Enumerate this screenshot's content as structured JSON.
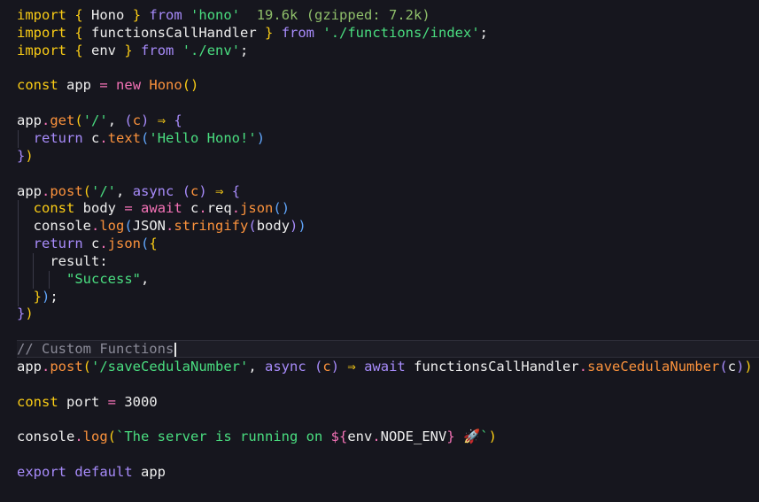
{
  "colors": {
    "background": "#16161e",
    "keyword": "#facc15",
    "keyword_alt": "#a78bfa",
    "string": "#4ade80",
    "function": "#fb923c",
    "operator": "#f472b6",
    "comment": "#8b8b98"
  },
  "lines": [
    {
      "tokens": [
        {
          "t": "import",
          "c": "kw"
        },
        {
          "t": " ",
          "c": "id"
        },
        {
          "t": "{",
          "c": "br"
        },
        {
          "t": " Hono ",
          "c": "id"
        },
        {
          "t": "}",
          "c": "br"
        },
        {
          "t": " ",
          "c": "id"
        },
        {
          "t": "from",
          "c": "kw2"
        },
        {
          "t": " ",
          "c": "id"
        },
        {
          "t": "'hono'",
          "c": "str"
        },
        {
          "t": "  19.6k (gzipped: 7.2k)",
          "c": "hint"
        }
      ]
    },
    {
      "tokens": [
        {
          "t": "import",
          "c": "kw"
        },
        {
          "t": " ",
          "c": "id"
        },
        {
          "t": "{",
          "c": "br"
        },
        {
          "t": " functionsCallHandler ",
          "c": "id"
        },
        {
          "t": "}",
          "c": "br"
        },
        {
          "t": " ",
          "c": "id"
        },
        {
          "t": "from",
          "c": "kw2"
        },
        {
          "t": " ",
          "c": "id"
        },
        {
          "t": "'./functions/index'",
          "c": "str"
        },
        {
          "t": ";",
          "c": "id"
        }
      ]
    },
    {
      "tokens": [
        {
          "t": "import",
          "c": "kw"
        },
        {
          "t": " ",
          "c": "id"
        },
        {
          "t": "{",
          "c": "br"
        },
        {
          "t": " env ",
          "c": "id"
        },
        {
          "t": "}",
          "c": "br"
        },
        {
          "t": " ",
          "c": "id"
        },
        {
          "t": "from",
          "c": "kw2"
        },
        {
          "t": " ",
          "c": "id"
        },
        {
          "t": "'./env'",
          "c": "str"
        },
        {
          "t": ";",
          "c": "id"
        }
      ]
    },
    {
      "tokens": []
    },
    {
      "tokens": [
        {
          "t": "const",
          "c": "kw"
        },
        {
          "t": " app ",
          "c": "id"
        },
        {
          "t": "=",
          "c": "op"
        },
        {
          "t": " ",
          "c": "id"
        },
        {
          "t": "new",
          "c": "op"
        },
        {
          "t": " ",
          "c": "id"
        },
        {
          "t": "Hono",
          "c": "fn"
        },
        {
          "t": "()",
          "c": "br"
        }
      ]
    },
    {
      "tokens": []
    },
    {
      "tokens": [
        {
          "t": "app",
          "c": "id"
        },
        {
          "t": ".",
          "c": "op"
        },
        {
          "t": "get",
          "c": "fn"
        },
        {
          "t": "(",
          "c": "br"
        },
        {
          "t": "'/'",
          "c": "str"
        },
        {
          "t": ", ",
          "c": "id"
        },
        {
          "t": "(",
          "c": "kw2"
        },
        {
          "t": "c",
          "c": "fn"
        },
        {
          "t": ")",
          "c": "kw2"
        },
        {
          "t": " ",
          "c": "id"
        },
        {
          "t": "⇒",
          "c": "kw"
        },
        {
          "t": " ",
          "c": "id"
        },
        {
          "t": "{",
          "c": "kw2"
        }
      ]
    },
    {
      "tokens": [
        {
          "t": "  ",
          "c": "id"
        },
        {
          "t": "return",
          "c": "kw2"
        },
        {
          "t": " c",
          "c": "id"
        },
        {
          "t": ".",
          "c": "op"
        },
        {
          "t": "text",
          "c": "fn"
        },
        {
          "t": "(",
          "c": "ob"
        },
        {
          "t": "'Hello Hono!'",
          "c": "str"
        },
        {
          "t": ")",
          "c": "ob"
        }
      ]
    },
    {
      "tokens": [
        {
          "t": "}",
          "c": "kw2"
        },
        {
          "t": ")",
          "c": "br"
        }
      ]
    },
    {
      "tokens": []
    },
    {
      "tokens": [
        {
          "t": "app",
          "c": "id"
        },
        {
          "t": ".",
          "c": "op"
        },
        {
          "t": "post",
          "c": "fn"
        },
        {
          "t": "(",
          "c": "br"
        },
        {
          "t": "'/'",
          "c": "str"
        },
        {
          "t": ", ",
          "c": "id"
        },
        {
          "t": "async",
          "c": "kw2"
        },
        {
          "t": " ",
          "c": "id"
        },
        {
          "t": "(",
          "c": "kw2"
        },
        {
          "t": "c",
          "c": "fn"
        },
        {
          "t": ")",
          "c": "kw2"
        },
        {
          "t": " ",
          "c": "id"
        },
        {
          "t": "⇒",
          "c": "kw"
        },
        {
          "t": " ",
          "c": "id"
        },
        {
          "t": "{",
          "c": "kw2"
        }
      ]
    },
    {
      "tokens": [
        {
          "t": "  ",
          "c": "id"
        },
        {
          "t": "const",
          "c": "kw"
        },
        {
          "t": " body ",
          "c": "id"
        },
        {
          "t": "=",
          "c": "op"
        },
        {
          "t": " ",
          "c": "id"
        },
        {
          "t": "await",
          "c": "op"
        },
        {
          "t": " c",
          "c": "id"
        },
        {
          "t": ".",
          "c": "op"
        },
        {
          "t": "req",
          "c": "id"
        },
        {
          "t": ".",
          "c": "op"
        },
        {
          "t": "json",
          "c": "fn"
        },
        {
          "t": "()",
          "c": "ob"
        }
      ]
    },
    {
      "tokens": [
        {
          "t": "  console",
          "c": "id"
        },
        {
          "t": ".",
          "c": "op"
        },
        {
          "t": "log",
          "c": "fn"
        },
        {
          "t": "(",
          "c": "ob"
        },
        {
          "t": "JSON",
          "c": "id"
        },
        {
          "t": ".",
          "c": "op"
        },
        {
          "t": "stringify",
          "c": "fn"
        },
        {
          "t": "(",
          "c": "kw2"
        },
        {
          "t": "body",
          "c": "id"
        },
        {
          "t": ")",
          "c": "kw2"
        },
        {
          "t": ")",
          "c": "ob"
        }
      ]
    },
    {
      "tokens": [
        {
          "t": "  ",
          "c": "id"
        },
        {
          "t": "return",
          "c": "kw2"
        },
        {
          "t": " c",
          "c": "id"
        },
        {
          "t": ".",
          "c": "op"
        },
        {
          "t": "json",
          "c": "fn"
        },
        {
          "t": "(",
          "c": "ob"
        },
        {
          "t": "{",
          "c": "kw"
        }
      ]
    },
    {
      "tokens": [
        {
          "t": "    result",
          "c": "id"
        },
        {
          "t": ":",
          "c": "id"
        }
      ]
    },
    {
      "tokens": [
        {
          "t": "      ",
          "c": "id"
        },
        {
          "t": "\"Success\"",
          "c": "str"
        },
        {
          "t": ",",
          "c": "id"
        }
      ]
    },
    {
      "tokens": [
        {
          "t": "  ",
          "c": "id"
        },
        {
          "t": "}",
          "c": "kw"
        },
        {
          "t": ")",
          "c": "ob"
        },
        {
          "t": ";",
          "c": "id"
        }
      ]
    },
    {
      "tokens": [
        {
          "t": "}",
          "c": "kw2"
        },
        {
          "t": ")",
          "c": "br"
        }
      ]
    },
    {
      "tokens": []
    },
    {
      "tokens": [
        {
          "t": "// Custom Functions",
          "c": "cm"
        }
      ],
      "active": true
    },
    {
      "tokens": [
        {
          "t": "app",
          "c": "id"
        },
        {
          "t": ".",
          "c": "op"
        },
        {
          "t": "post",
          "c": "fn"
        },
        {
          "t": "(",
          "c": "br"
        },
        {
          "t": "'/saveCedulaNumber'",
          "c": "str"
        },
        {
          "t": ", ",
          "c": "id"
        },
        {
          "t": "async",
          "c": "kw2"
        },
        {
          "t": " ",
          "c": "id"
        },
        {
          "t": "(",
          "c": "kw2"
        },
        {
          "t": "c",
          "c": "fn"
        },
        {
          "t": ")",
          "c": "kw2"
        },
        {
          "t": " ",
          "c": "id"
        },
        {
          "t": "⇒",
          "c": "kw"
        },
        {
          "t": " ",
          "c": "id"
        },
        {
          "t": "await",
          "c": "kw2"
        },
        {
          "t": " functionsCallHandler",
          "c": "id"
        },
        {
          "t": ".",
          "c": "op"
        },
        {
          "t": "saveCedulaNumber",
          "c": "fn"
        },
        {
          "t": "(",
          "c": "kw2"
        },
        {
          "t": "c",
          "c": "id"
        },
        {
          "t": ")",
          "c": "kw2"
        },
        {
          "t": ")",
          "c": "br"
        }
      ]
    },
    {
      "tokens": []
    },
    {
      "tokens": [
        {
          "t": "const",
          "c": "kw"
        },
        {
          "t": " port ",
          "c": "id"
        },
        {
          "t": "=",
          "c": "op"
        },
        {
          "t": " 3000",
          "c": "num"
        }
      ]
    },
    {
      "tokens": []
    },
    {
      "tokens": [
        {
          "t": "console",
          "c": "id"
        },
        {
          "t": ".",
          "c": "op"
        },
        {
          "t": "log",
          "c": "fn"
        },
        {
          "t": "(",
          "c": "br"
        },
        {
          "t": "`The server is running on ",
          "c": "str"
        },
        {
          "t": "${",
          "c": "op"
        },
        {
          "t": "env",
          "c": "id"
        },
        {
          "t": ".",
          "c": "op"
        },
        {
          "t": "NODE_ENV",
          "c": "id"
        },
        {
          "t": "}",
          "c": "op"
        },
        {
          "t": " 🚀`",
          "c": "str"
        },
        {
          "t": ")",
          "c": "br"
        }
      ]
    },
    {
      "tokens": []
    },
    {
      "tokens": [
        {
          "t": "export",
          "c": "kw2"
        },
        {
          "t": " ",
          "c": "id"
        },
        {
          "t": "default",
          "c": "kw2"
        },
        {
          "t": " app",
          "c": "id"
        }
      ]
    }
  ]
}
